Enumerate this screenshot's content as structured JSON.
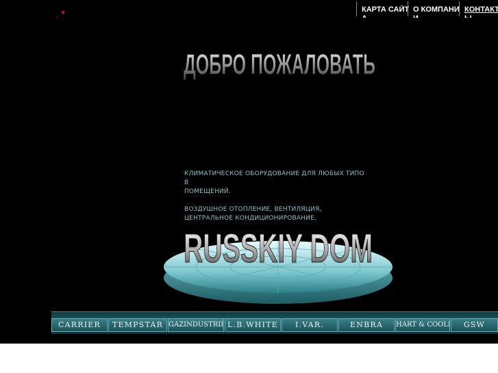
{
  "nav": {
    "items": [
      {
        "label": "КАРТА САЙТ\nА",
        "active": false
      },
      {
        "label": "О КОМПАНИ\nИ",
        "active": false
      },
      {
        "label": "КОНТАКТ\nЫ",
        "active": true
      }
    ]
  },
  "welcome": {
    "title": "ДОБРО ПОЖАЛОВАТЬ"
  },
  "description": {
    "line1": "КЛИМАТИЧЕСКОЕ ОБОРУДОВАНИЕ ДЛЯ ЛЮБЫХ ТИПО",
    "line2": "В",
    "line3": "ПОМЕЩЕНИЙ.",
    "line4": "ВОЗДУШНОЕ ОТОПЛЕНИЕ,   ВЕНТИЛЯЦИЯ,",
    "line5": "ЦЕНТРАЛЬНОЕ КОНДИЦИОНИРОВАНИЕ,"
  },
  "logo": {
    "text": "RUSSKIY DOM"
  },
  "brands": [
    "CARRIER",
    "TEMPSTAR",
    "GAZINDUSTRIE",
    "L.B.WHITE",
    "I.VAR.",
    "ENBRA",
    "HART & COOLEY",
    "GSW"
  ],
  "colors": {
    "background": "#000000",
    "accent": "#3a7d86",
    "description_text": "#8fc0c8"
  }
}
